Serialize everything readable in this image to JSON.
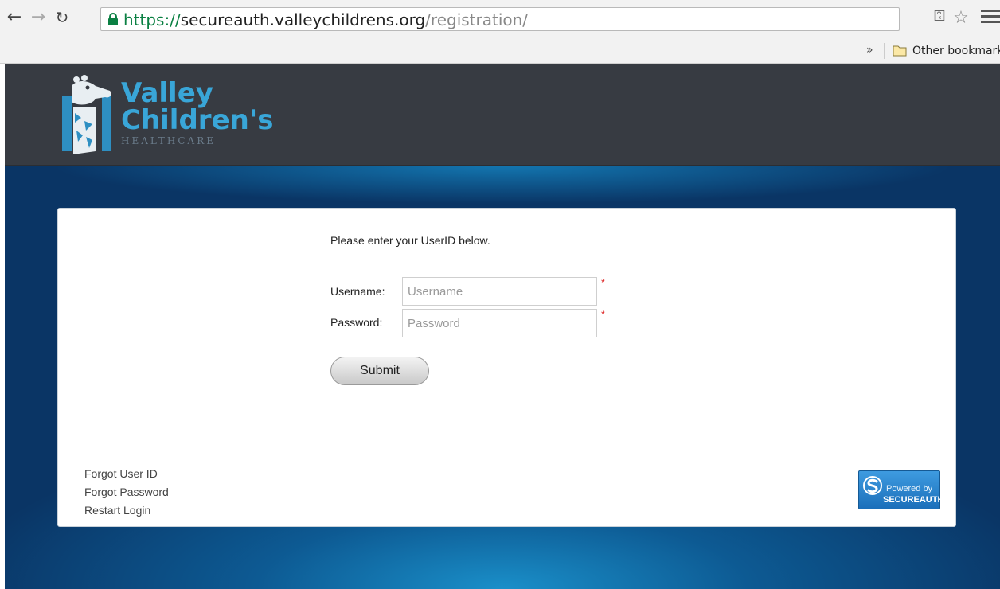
{
  "browser": {
    "url_scheme": "https://",
    "url_host": "secureauth.valleychildrens.org",
    "url_path": "/registration/",
    "bookmarks_overflow": "»",
    "bookmarks_folder_label": "Other bookmarks"
  },
  "header": {
    "logo_line1": "Valley",
    "logo_line2": "Children's",
    "logo_line3": "HEALTHCARE"
  },
  "form": {
    "instruction": "Please enter your UserID below.",
    "username_label": "Username:",
    "username_placeholder": "Username",
    "username_value": "",
    "password_label": "Password:",
    "password_placeholder": "Password",
    "password_value": "",
    "required_marker": "*",
    "submit_label": "Submit"
  },
  "footer": {
    "links": [
      "Forgot User ID",
      "Forgot Password",
      "Restart Login"
    ],
    "badge_line1": "Powered by",
    "badge_line2": "SECUREAUTH"
  },
  "colors": {
    "header_bg": "#373b42",
    "brand_blue": "#39a6d8",
    "main_bg": "#0a3565",
    "required": "#dd2222"
  }
}
